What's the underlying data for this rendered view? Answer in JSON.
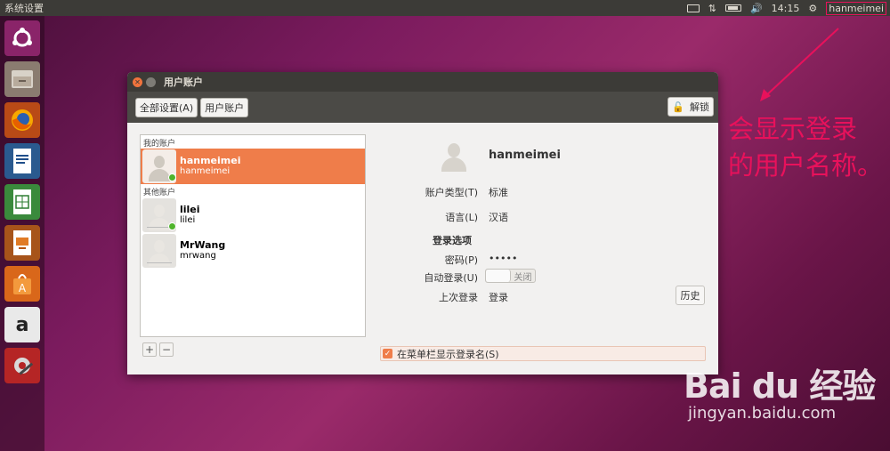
{
  "topbar": {
    "app_title": "系统设置",
    "time": "14:15",
    "user": "hanmeimei",
    "icons": [
      "keyboard-icon",
      "network-icon",
      "battery-icon",
      "volume-icon",
      "gear-icon"
    ]
  },
  "launcher": {
    "items": [
      {
        "name": "ubuntu-logo-icon",
        "color": "#7b1b5e"
      },
      {
        "name": "files-icon",
        "color": "#7a6b5e"
      },
      {
        "name": "firefox-icon",
        "color": "#e66000"
      },
      {
        "name": "libreoffice-writer-icon",
        "color": "#1f4e8a"
      },
      {
        "name": "libreoffice-calc-icon",
        "color": "#2e7d32"
      },
      {
        "name": "libreoffice-impress-icon",
        "color": "#b45309"
      },
      {
        "name": "software-center-icon",
        "color": "#e8731a"
      },
      {
        "name": "amazon-icon",
        "color": "#444444"
      },
      {
        "name": "system-settings-icon",
        "color": "#b91c1c"
      }
    ]
  },
  "window": {
    "title": "用户账户",
    "toolbar": {
      "all_settings": "全部设置(A)",
      "user_accounts": "用户账户",
      "unlock": "解锁"
    },
    "list": {
      "my_account_header": "我的账户",
      "other_accounts_header": "其他账户",
      "users": [
        {
          "display": "hanmeimei",
          "login": "hanmeimei",
          "online": true,
          "selected": true
        },
        {
          "display": "lilei",
          "login": "lilei",
          "online": true,
          "selected": false
        },
        {
          "display": "MrWang",
          "login": "mrwang",
          "online": false,
          "selected": false
        }
      ],
      "add_label": "+",
      "remove_label": "−"
    },
    "detail": {
      "name": "hanmeimei",
      "account_type_label": "账户类型(T)",
      "account_type_value": "标准",
      "language_label": "语言(L)",
      "language_value": "汉语",
      "login_options_heading": "登录选项",
      "password_label": "密码(P)",
      "password_value": "•••••",
      "auto_login_label": "自动登录(U)",
      "auto_login_value": "关闭",
      "last_login_label": "上次登录",
      "last_login_value": "登录",
      "history_button": "历史"
    },
    "show_login_name_checkbox": "在菜单栏显示登录名(S)",
    "checkbox_checked": true
  },
  "annotation": {
    "line1": "会显示登录",
    "line2": "的用户名称。",
    "color": "#e8115b"
  },
  "watermark": {
    "logo": "Bai du 经验",
    "url": "jingyan.baidu.com"
  }
}
